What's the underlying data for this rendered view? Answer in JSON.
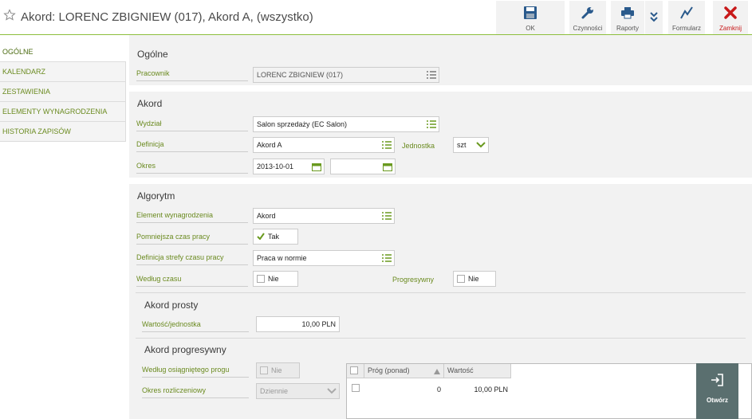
{
  "header": {
    "title": "Akord: LORENC ZBIGNIEW (017), Akord A, (wszystko)",
    "toolbar": {
      "ok_label": "OK",
      "czynnosci_label": "Czynności",
      "raporty_label": "Raporty",
      "formularz_label": "Formularz",
      "zamknij_label": "Zamknij"
    }
  },
  "nav": {
    "items": [
      {
        "label": "OGÓLNE"
      },
      {
        "label": "KALENDARZ"
      },
      {
        "label": "ZESTAWIENIA"
      },
      {
        "label": "ELEMENTY WYNAGRODZENIA"
      },
      {
        "label": "HISTORIA ZAPISÓW"
      }
    ]
  },
  "ogolne": {
    "title": "Ogólne",
    "pracownik_label": "Pracownik",
    "pracownik_value": "LORENC ZBIGNIEW (017)"
  },
  "akord": {
    "title": "Akord",
    "wydzial_label": "Wydział",
    "wydzial_value": "Salon sprzedaży (EC Salon)",
    "definicja_label": "Definicja",
    "definicja_value": "Akord A",
    "jednostka_label": "Jednostka",
    "jednostka_value": "szt",
    "okres_label": "Okres",
    "okres_from": "2013-10-01",
    "okres_to": ""
  },
  "algorytm": {
    "title": "Algorytm",
    "element_label": "Element wynagrodzenia",
    "element_value": "Akord",
    "pomniejsza_label": "Pomniejsza czas pracy",
    "pomniejsza_value": "Tak",
    "definicja_strefy_label": "Definicja strefy czasu pracy",
    "definicja_strefy_value": "Praca w normie",
    "wedlug_czasu_label": "Według czasu",
    "wedlug_czasu_value": "Nie",
    "progresywny_label": "Progresywny",
    "progresywny_value": "Nie"
  },
  "akord_prosty": {
    "title": "Akord prosty",
    "wartosc_label": "Wartość/jednostka",
    "wartosc_value": "10,00 PLN"
  },
  "akord_progresywny": {
    "title": "Akord progresywny",
    "wedlug_progu_label": "Według osiągniętego progu",
    "wedlug_progu_value": "Nie",
    "okres_label": "Okres rozliczeniowy",
    "okres_value": "Dziennie",
    "grid": {
      "columns": [
        "Próg (ponad)",
        "Wartość"
      ],
      "rows": [
        {
          "prog": "0",
          "wartosc": "10,00 PLN"
        }
      ]
    },
    "open_label": "Otwórz"
  },
  "colors": {
    "accent": "#8dbf3c",
    "label_green": "#6a8a1f",
    "close_red": "#c8191a",
    "icon_blue": "#2a5a8c",
    "open_button": "#5a6f6f"
  }
}
